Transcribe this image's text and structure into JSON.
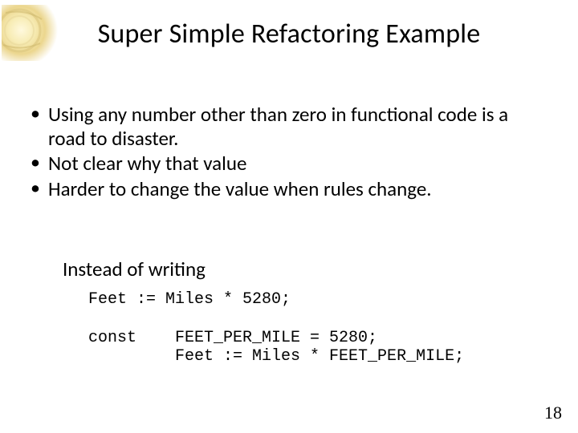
{
  "title": "Super Simple Refactoring Example",
  "bullets": [
    "Using any number other than zero in functional code is a road to disaster.",
    "Not clear why that value",
    "Harder to change the value when rules change."
  ],
  "instead_label": "Instead of writing",
  "code_before": "Feet := Miles * 5280;",
  "code_after": "const    FEET_PER_MILE = 5280;\n         Feet := Miles * FEET_PER_MILE;",
  "page_number": "18"
}
